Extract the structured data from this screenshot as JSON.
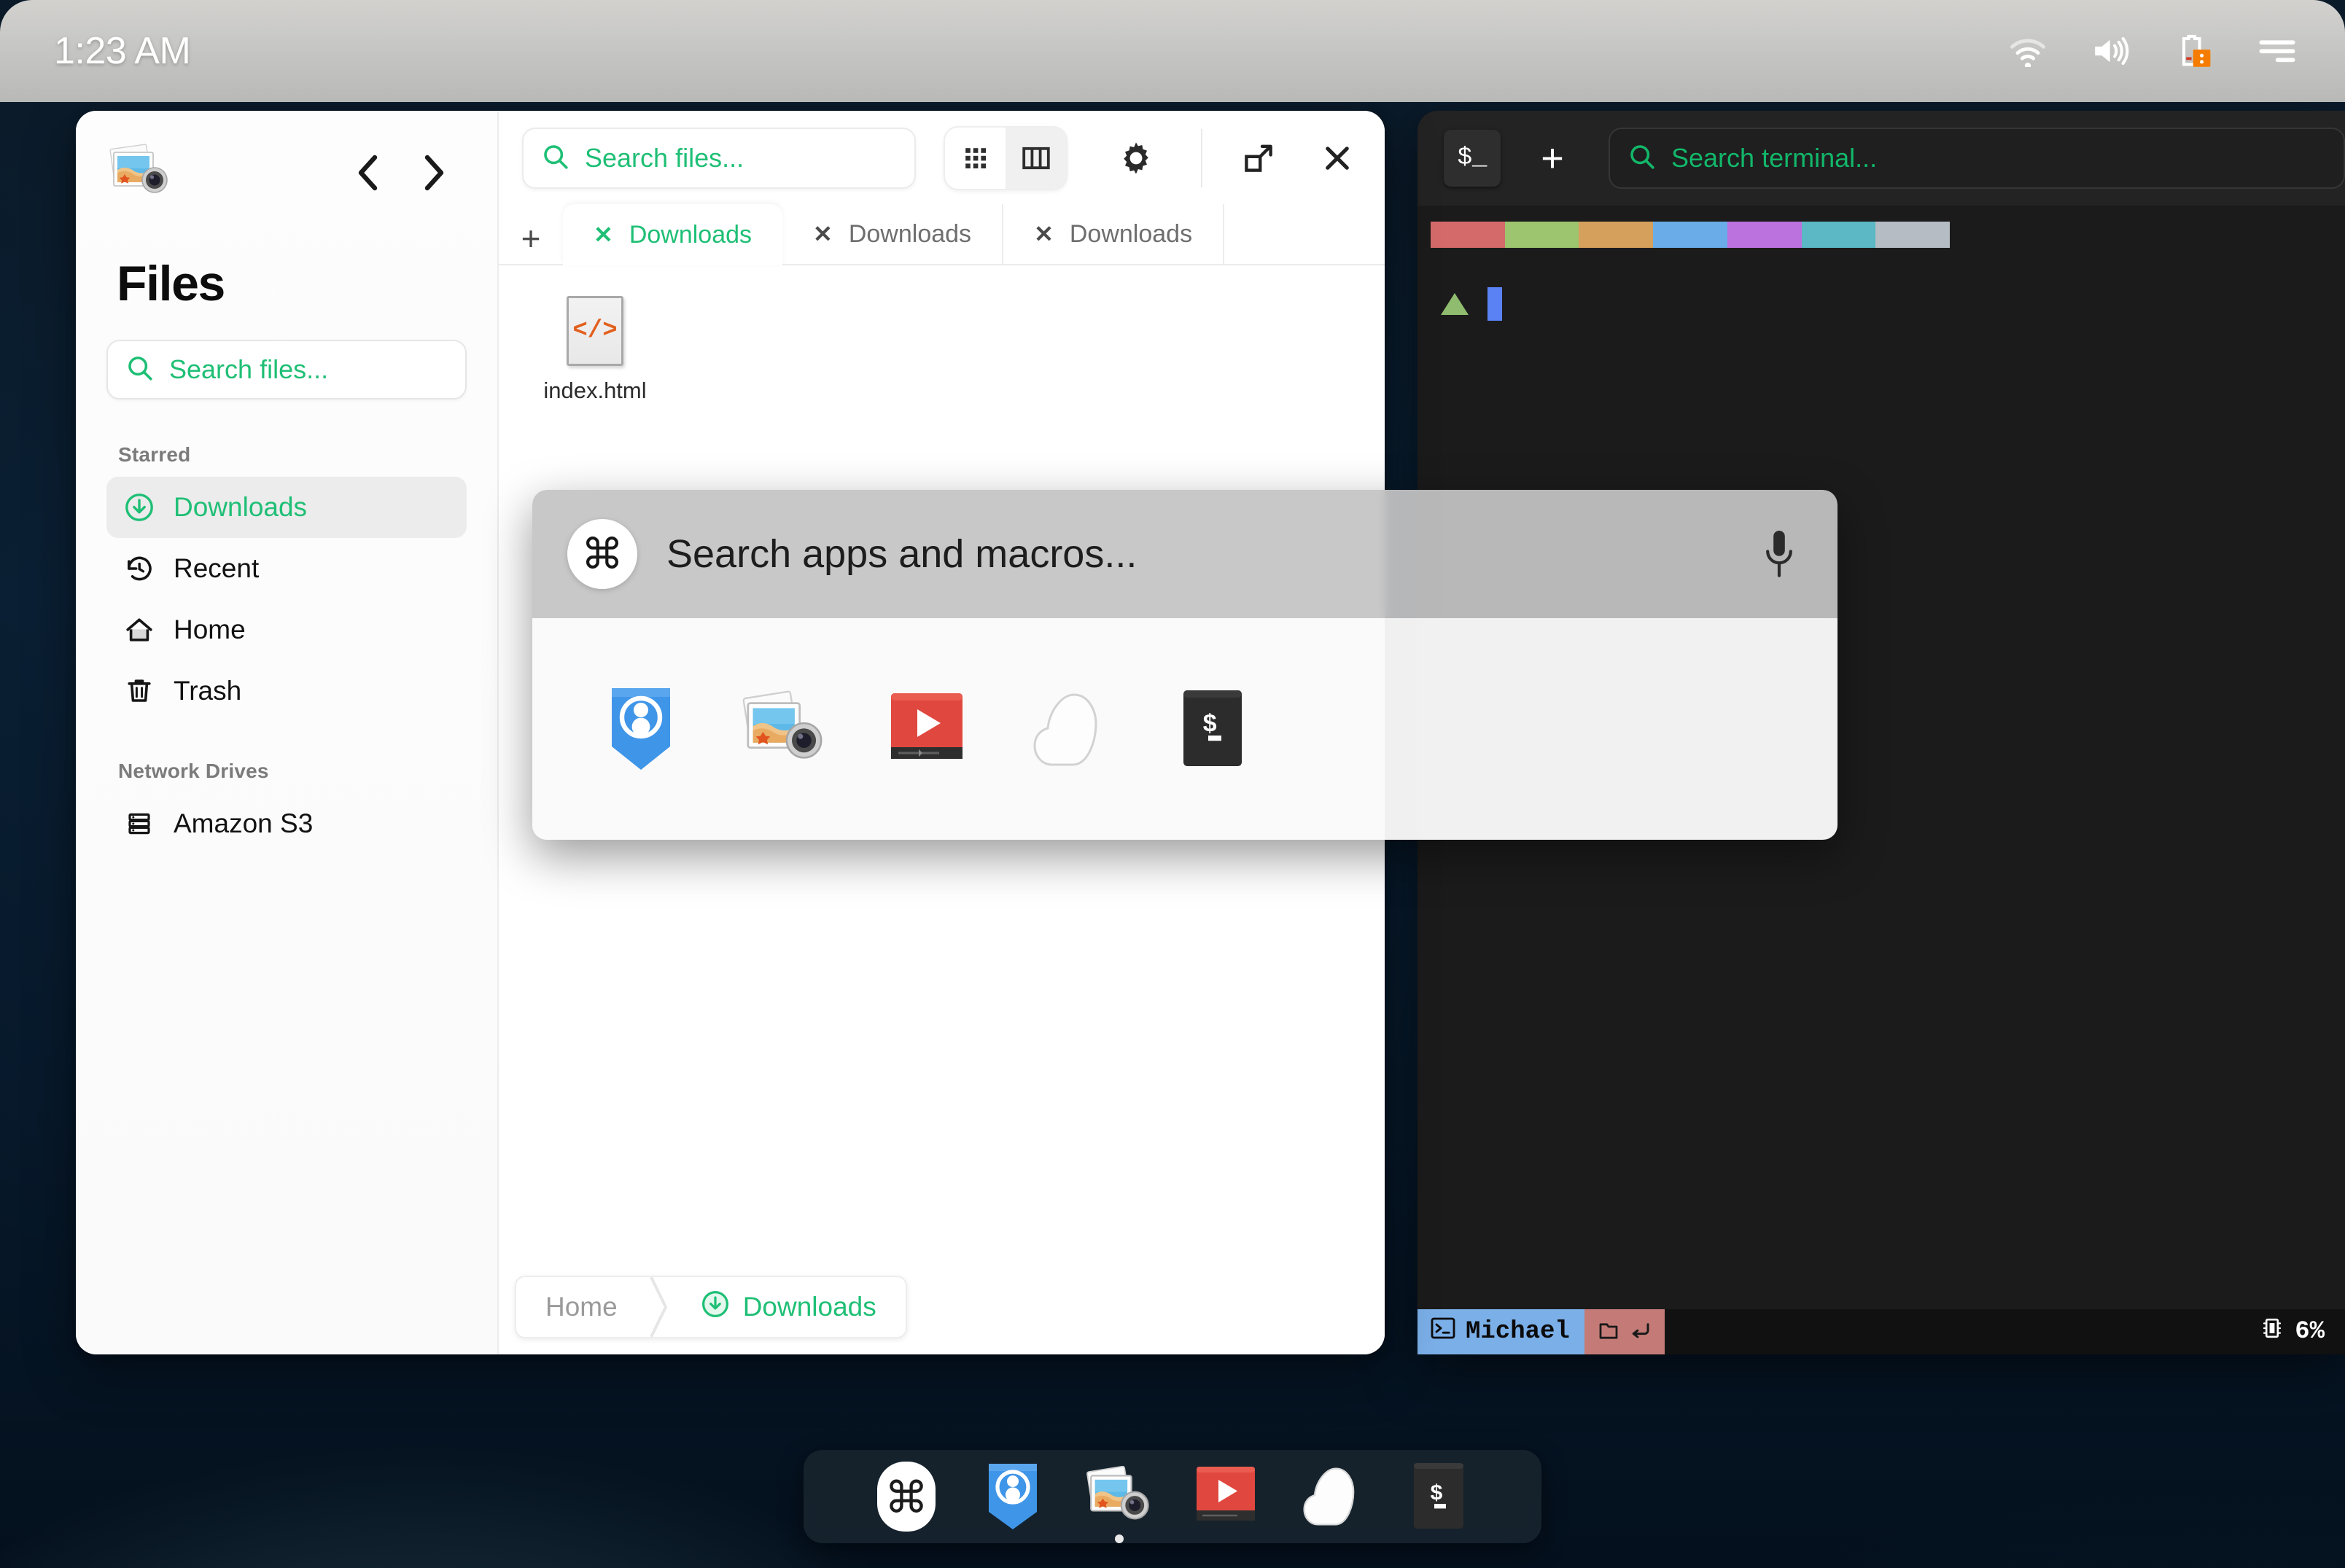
{
  "topbar": {
    "clock": "1:23 AM",
    "tray": [
      {
        "name": "wifi-icon",
        "label": "Wi-Fi"
      },
      {
        "name": "volume-icon",
        "label": "Volume"
      },
      {
        "name": "battery-warning-icon",
        "label": "Battery"
      },
      {
        "name": "menu-icon",
        "label": "Menu"
      }
    ]
  },
  "files_window": {
    "app_icon": "photos-app-icon",
    "title": "Files",
    "nav": {
      "back": "back-chevron-icon",
      "forward": "forward-chevron-icon"
    },
    "sidebar_search": {
      "placeholder": "Search files...",
      "value": "",
      "icon": "search-icon"
    },
    "groups": [
      {
        "label": "Starred",
        "items": [
          {
            "label": "Downloads",
            "icon": "download-circle-icon",
            "active": true
          },
          {
            "label": "Recent",
            "icon": "history-icon",
            "active": false
          },
          {
            "label": "Home",
            "icon": "home-icon",
            "active": false
          },
          {
            "label": "Trash",
            "icon": "trash-icon",
            "active": false
          }
        ]
      },
      {
        "label": "Network Drives",
        "items": [
          {
            "label": "Amazon S3",
            "icon": "server-icon",
            "active": false
          }
        ]
      }
    ],
    "toolbar": {
      "search": {
        "placeholder": "Search files...",
        "value": "",
        "icon": "search-icon"
      },
      "view_grid": "grid-view-icon",
      "view_columns": "column-view-icon",
      "selected_view": "columns",
      "settings": "gear-icon",
      "maximize": "maximize-icon",
      "close": "close-icon"
    },
    "tabs": {
      "add_label": "+",
      "items": [
        {
          "label": "Downloads",
          "active": true
        },
        {
          "label": "Downloads",
          "active": false
        },
        {
          "label": "Downloads",
          "active": false
        }
      ]
    },
    "files": [
      {
        "name": "index.html",
        "icon_glyph": "</>",
        "type": "html"
      }
    ],
    "breadcrumb": [
      {
        "label": "Home",
        "current": false,
        "icon": null
      },
      {
        "label": "Downloads",
        "current": true,
        "icon": "download-circle-icon"
      }
    ]
  },
  "terminal_window": {
    "app_icon_glyph": "$_",
    "add_tab_label": "+",
    "search": {
      "placeholder": "Search terminal...",
      "value": "",
      "icon": "search-icon"
    },
    "color_swatches": [
      "#d46a6a",
      "#9dc46f",
      "#d4a05c",
      "#6aace8",
      "#bb72de",
      "#5bb8c4",
      "#b5bcc4"
    ],
    "prompt": {
      "symbol": "triangle",
      "cursor": "block"
    },
    "status": {
      "user": "Michael",
      "user_icon": "terminal-icon",
      "dir_icon": "folder-icon",
      "dir_arrow_icon": "return-arrow-icon",
      "cpu_label": "6%",
      "cpu_icon": "cpu-icon"
    }
  },
  "palette": {
    "cmd_glyph": "⌘",
    "placeholder": "Search apps and macros...",
    "value": "",
    "mic_icon": "microphone-icon",
    "apps": [
      {
        "name": "contacts-app-icon",
        "label": "Contacts"
      },
      {
        "name": "photos-app-icon",
        "label": "Photos"
      },
      {
        "name": "video-app-icon",
        "label": "Video"
      },
      {
        "name": "cloud-app-icon",
        "label": "Cloud"
      },
      {
        "name": "terminal-app-icon",
        "label": "Terminal"
      }
    ]
  },
  "dock": {
    "items": [
      {
        "name": "command-launcher-icon",
        "label": "Launcher",
        "running": false
      },
      {
        "name": "contacts-app-icon",
        "label": "Contacts",
        "running": false
      },
      {
        "name": "photos-app-icon",
        "label": "Photos",
        "running": true
      },
      {
        "name": "video-app-icon",
        "label": "Video",
        "running": false
      },
      {
        "name": "cloud-app-icon",
        "label": "Cloud",
        "running": false
      },
      {
        "name": "terminal-app-icon",
        "label": "Terminal",
        "running": false
      }
    ]
  },
  "colors": {
    "accent_green": "#1fbf75",
    "terminal_green": "#12b76a",
    "warning_orange": "#f57c00",
    "file_icon_orange": "#e2601e"
  }
}
